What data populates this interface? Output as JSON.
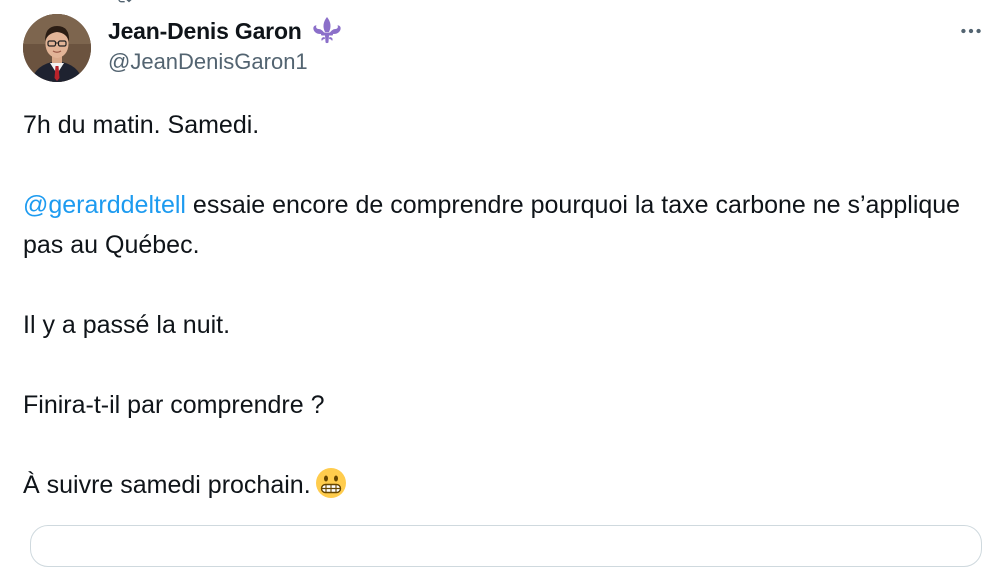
{
  "tweet": {
    "author": {
      "display_name": "Jean-Denis Garon",
      "handle": "@JeanDenisGaron1",
      "badge_icon": "fleur-de-lis-icon",
      "badge_color": "#8b6fc9"
    },
    "more_icon": "more-horizontal-icon",
    "body": {
      "line1": "7h du matin. Samedi.",
      "mention": "@gerarddeltell",
      "line2_rest": " essaie encore de comprendre pourquoi la taxe carbone ne s’applique pas au Québec.",
      "line3": "Il y a passé la nuit.",
      "line4": "Finira-t-il par comprendre ?",
      "line5": "À suivre samedi prochain.",
      "emoji": "grimacing-face-emoji"
    },
    "colors": {
      "text": "#0f1419",
      "secondary": "#536471",
      "link": "#1d9bf0",
      "border": "#cfd9de"
    }
  }
}
